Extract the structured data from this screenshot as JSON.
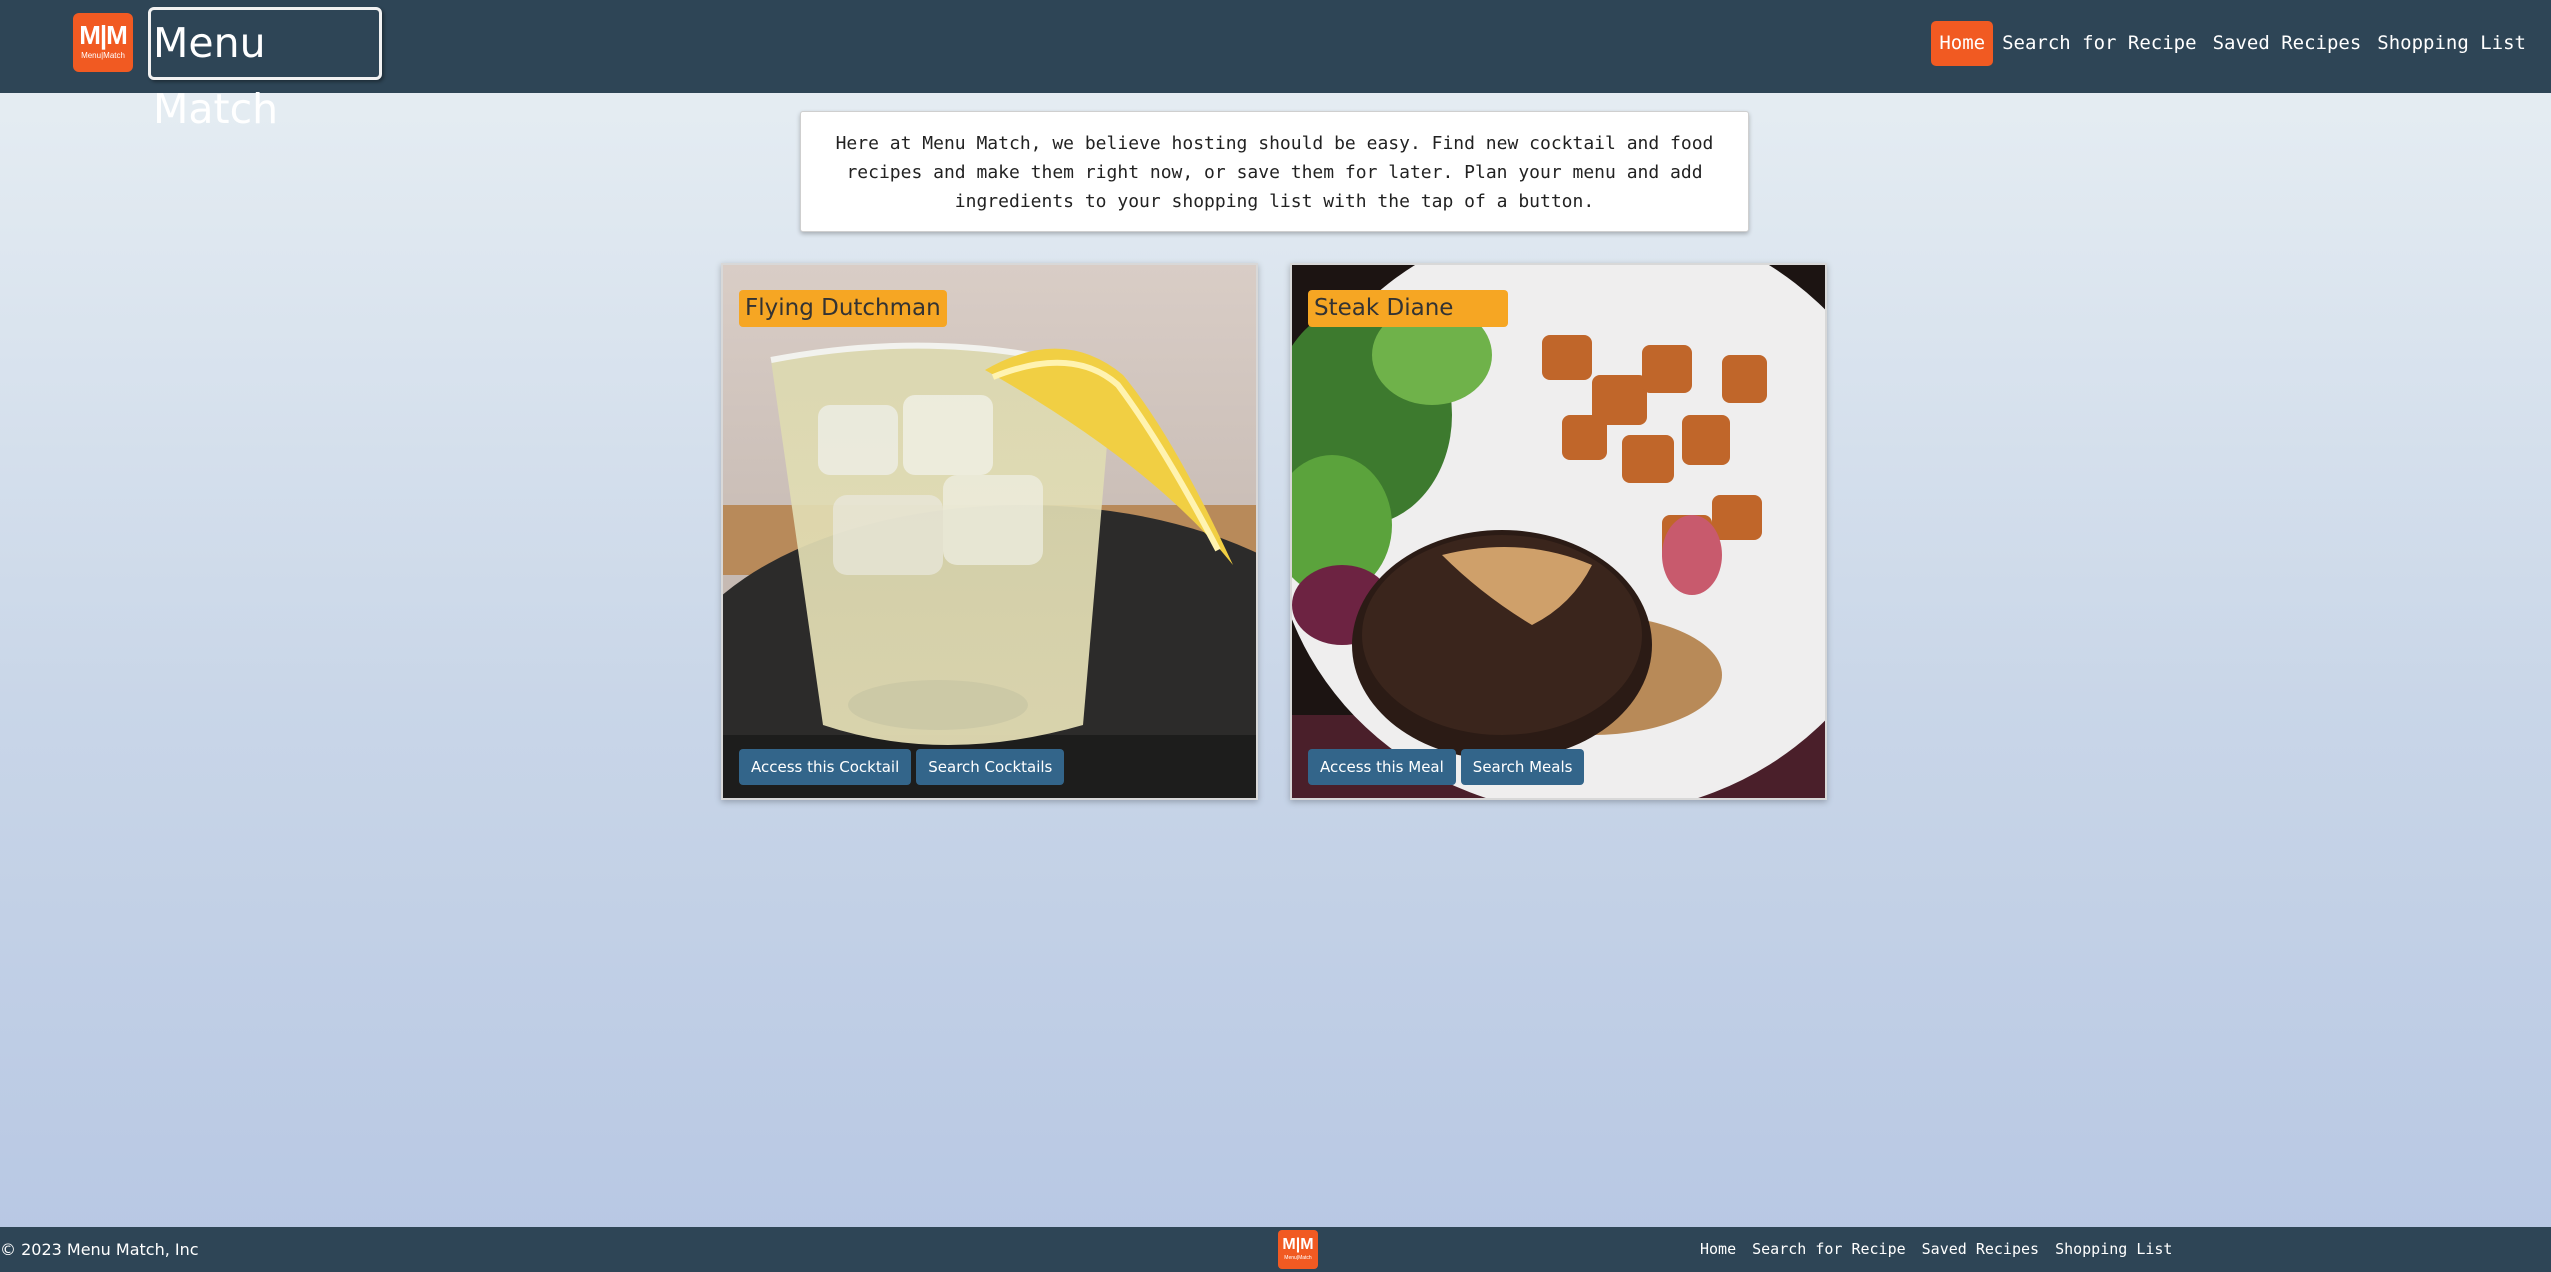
{
  "header": {
    "logo_text": "M|M",
    "logo_subtext": "Menu|Match",
    "brand": "Menu Match",
    "nav": [
      "Home",
      "Search for Recipe",
      "Saved Recipes",
      "Shopping List"
    ]
  },
  "intro": {
    "text": "Here at Menu Match, we believe hosting should be easy. Find new cocktail and food recipes and make them right now, or save them for later. Plan your menu and add ingredients to your shopping list with the tap of a button."
  },
  "cards": [
    {
      "title": "Flying Dutchman",
      "access_label": "Access this Cocktail",
      "search_label": "Search Cocktails",
      "image": "cocktail-glass-with-lemon"
    },
    {
      "title": "Steak Diane",
      "access_label": "Access this Meal",
      "search_label": "Search Meals",
      "image": "steak-with-potatoes-and-salad"
    }
  ],
  "footer": {
    "copyright": "© 2023 Menu Match, Inc",
    "logo_text": "M|M",
    "logo_subtext": "Menu|Match",
    "nav": [
      "Home",
      "Search for Recipe",
      "Saved Recipes",
      "Shopping List"
    ]
  },
  "colors": {
    "nav_bg": "#2e4556",
    "accent": "#f15a22",
    "title_badge": "#f6a623",
    "button": "#33658a"
  }
}
